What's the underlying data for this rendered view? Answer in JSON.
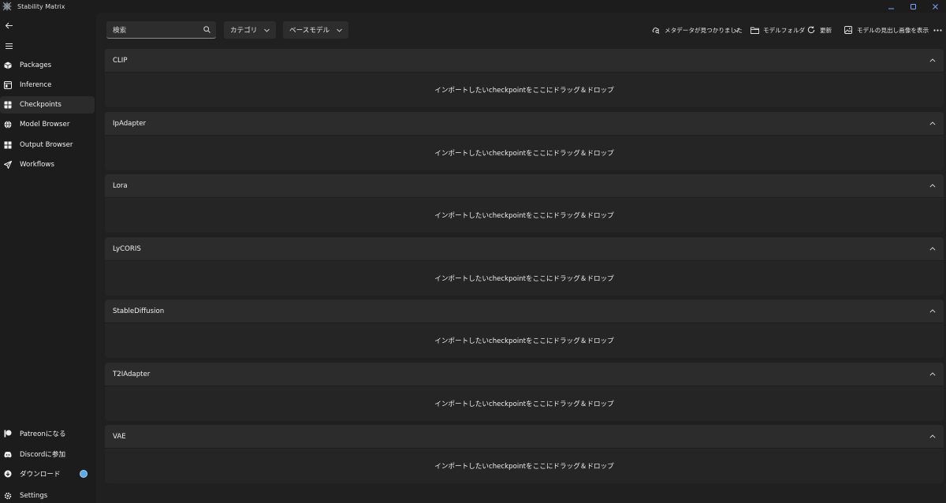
{
  "app": {
    "title": "Stability Matrix"
  },
  "window_controls": {
    "minimize": "⋯",
    "maximize": "▢",
    "close": "✕"
  },
  "sidebar": {
    "nav": [
      {
        "label": "Packages",
        "icon": "box-icon"
      },
      {
        "label": "Inference",
        "icon": "window-icon"
      },
      {
        "label": "Checkpoints",
        "icon": "grid-icon"
      },
      {
        "label": "Model Browser",
        "icon": "globe-icon"
      },
      {
        "label": "Output Browser",
        "icon": "apps-icon"
      },
      {
        "label": "Workflows",
        "icon": "send-icon"
      }
    ],
    "active": "Checkpoints",
    "footer": [
      {
        "label": "Patreonになる",
        "icon": "patreon-icon"
      },
      {
        "label": "Discordに参加",
        "icon": "discord-icon"
      },
      {
        "label": "ダウンロード",
        "icon": "download-icon"
      },
      {
        "label": "Settings",
        "icon": "gear-icon"
      }
    ]
  },
  "toolbar": {
    "search_placeholder": "検索",
    "category_label": "カテゴリ",
    "base_model_label": "ベースモデル",
    "metadata_label": "メタデータが見つかりました",
    "model_folder_label": "モデルフォルダ",
    "refresh_label": "更新",
    "show_images_label": "モデルの見出し画像を表示"
  },
  "sections": [
    {
      "title": "CLIP",
      "drop_text": "インポートしたいcheckpointをここにドラッグ＆ドロップ"
    },
    {
      "title": "IpAdapter",
      "drop_text": "インポートしたいcheckpointをここにドラッグ＆ドロップ"
    },
    {
      "title": "Lora",
      "drop_text": "インポートしたいcheckpointをここにドラッグ＆ドロップ"
    },
    {
      "title": "LyCORIS",
      "drop_text": "インポートしたいcheckpointをここにドラッグ＆ドロップ"
    },
    {
      "title": "StableDiffusion",
      "drop_text": "インポートしたいcheckpointをここにドラッグ＆ドロップ"
    },
    {
      "title": "T2IAdapter",
      "drop_text": "インポートしたいcheckpointをここにドラッグ＆ドロップ"
    },
    {
      "title": "VAE",
      "drop_text": "インポートしたいcheckpointをここにドラッグ＆ドロップ"
    }
  ],
  "colors": {
    "accent": "#5fa8e6",
    "background": "#202020",
    "sidebar": "#1c1c1c",
    "section_header": "#2c2c2c"
  }
}
